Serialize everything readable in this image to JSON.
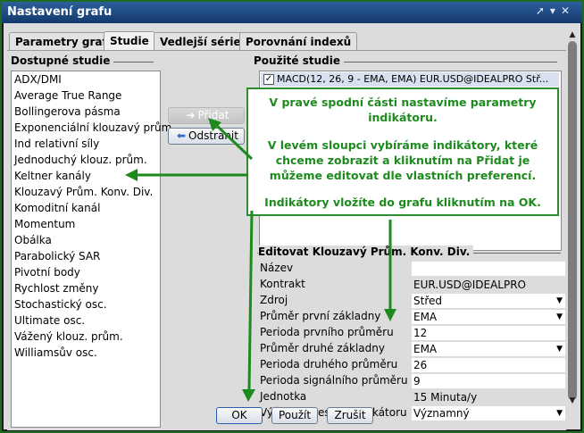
{
  "window": {
    "title": "Nastavení grafu"
  },
  "tabs": [
    {
      "label": "Parametry grafu",
      "active": false
    },
    {
      "label": "Studie",
      "active": true
    },
    {
      "label": "Vedlejší série",
      "active": false
    },
    {
      "label": "Porovnání indexů",
      "active": false
    }
  ],
  "available": {
    "heading": "Dostupné studie",
    "items": [
      "ADX/DMI",
      "Average True Range",
      "Bollingerova pásma",
      "Exponenciální klouzavý prům.",
      "Ind relativní síly",
      "Jednoduchý klouz. prům.",
      "Keltner kanály",
      "Klouzavý Prům. Konv. Div.",
      "Komoditní kanál",
      "Momentum",
      "Obálka",
      "Parabolický SAR",
      "Pivotní body",
      "Rychlost změny",
      "Stochastický osc.",
      "Ultimate osc.",
      "Vážený klouz. prům.",
      "Williamsův osc."
    ]
  },
  "buttons": {
    "add": "Přidat",
    "remove": "Odstranit"
  },
  "used": {
    "heading": "Použité studie",
    "items": [
      {
        "label": "MACD(12, 26, 9 - EMA, EMA) EUR.USD@IDEALPRO Stř...",
        "checked": true
      }
    ]
  },
  "edit": {
    "heading": "Editovat Klouzavý Prům. Konv. Div.",
    "fields": [
      {
        "label": "Název",
        "value": "",
        "dropdown": false,
        "readonly": false
      },
      {
        "label": "Kontrakt",
        "value": "EUR.USD@IDEALPRO",
        "dropdown": false,
        "readonly": true
      },
      {
        "label": "Zdroj",
        "value": "Střed",
        "dropdown": true,
        "readonly": false
      },
      {
        "label": "Průměr první základny",
        "value": "EMA",
        "dropdown": true,
        "readonly": false
      },
      {
        "label": "Perioda prvního průměru",
        "value": "12",
        "dropdown": false,
        "readonly": false
      },
      {
        "label": "Průměr druhé základny",
        "value": "EMA",
        "dropdown": true,
        "readonly": false
      },
      {
        "label": "Perioda druhého průměru",
        "value": "26",
        "dropdown": false,
        "readonly": false
      },
      {
        "label": "Perioda signálního průměru",
        "value": "9",
        "dropdown": false,
        "readonly": false
      },
      {
        "label": "Jednotka",
        "value": "15 Minuta/y",
        "dropdown": false,
        "readonly": true
      },
      {
        "label": "Výška vykreslení indikátoru",
        "value": "Významný",
        "dropdown": true,
        "readonly": false
      }
    ]
  },
  "callout": {
    "p1": "V pravé spodní části nastavíme parametry indikátoru.",
    "p2": "V levém sloupci vybíráme indikátory, které chceme zobrazit a kliknutím na Přidat je můžeme editovat dle vlastních preferencí.",
    "p3": "Indikátory vložíte do grafu kliknutím na OK."
  },
  "footer": {
    "ok": "OK",
    "apply": "Použít",
    "cancel": "Zrušit"
  },
  "colors": {
    "annotation": "#1d8a1d",
    "titlebar": "#1f4f8c",
    "selection": "#d7e1ef"
  },
  "icons": {
    "titlebar": [
      "pin-icon",
      "chevron-down-icon",
      "close-icon"
    ],
    "add": "arrow-right-icon",
    "remove": "arrow-left-icon"
  }
}
